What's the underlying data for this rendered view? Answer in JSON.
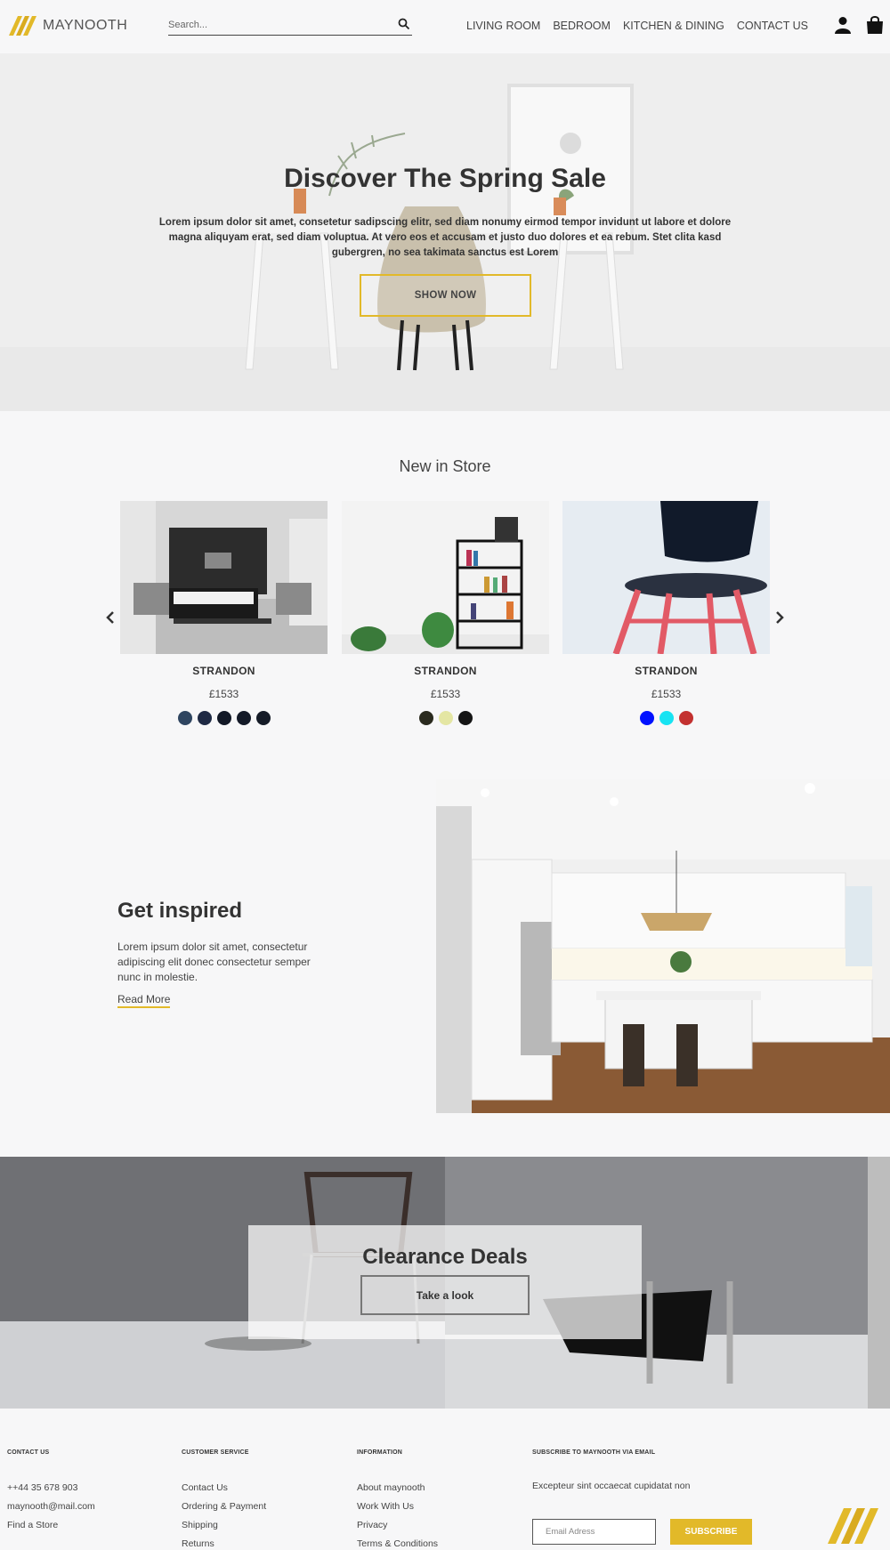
{
  "header": {
    "brand": "MAYNOOTH",
    "search_placeholder": "Search...",
    "nav": [
      "LIVING ROOM",
      "BEDROOM",
      "KITCHEN & DINING",
      "CONTACT US"
    ]
  },
  "hero": {
    "title": "Discover The Spring Sale",
    "text": "Lorem ipsum dolor sit amet, consetetur sadipscing elitr, sed diam nonumy eirmod tempor invidunt ut labore et dolore magna aliquyam erat, sed diam voluptua. At vero eos et accusam et justo duo dolores et ea rebum. Stet clita kasd gubergren, no sea takimata sanctus est Lorem",
    "button": "SHOW NOW"
  },
  "new_in_store": {
    "title": "New in Store",
    "products": [
      {
        "name": "STRANDON",
        "price": "£1533",
        "swatches": [
          "#2f4560",
          "#1f2a44",
          "#121826",
          "#141a28",
          "#151b27"
        ]
      },
      {
        "name": "STRANDON",
        "price": "£1533",
        "swatches": [
          "#2a2a1e",
          "#e4e6a3",
          "#151515"
        ]
      },
      {
        "name": "STRANDON",
        "price": "£1533",
        "swatches": [
          "#0011ff",
          "#17e3f2",
          "#c33130"
        ]
      }
    ]
  },
  "inspired": {
    "title": "Get inspired",
    "text": "Lorem ipsum dolor sit amet, consectetur adipiscing elit donec consectetur semper nunc in molestie.",
    "link": "Read More"
  },
  "clearance": {
    "title": "Clearance Deals",
    "button": "Take a look"
  },
  "footer": {
    "contact": {
      "heading": "CONTACT US",
      "items": [
        "++44 35 678 903",
        "maynooth@mail.com",
        "Find a Store"
      ]
    },
    "service": {
      "heading": "CUSTOMER SERVICE",
      "items": [
        "Contact Us",
        "Ordering & Payment",
        "Shipping",
        "Returns"
      ]
    },
    "information": {
      "heading": "INFORMATION",
      "items": [
        "About maynooth",
        "Work With Us",
        "Privacy",
        "Terms & Conditions"
      ]
    },
    "subscribe": {
      "heading": "SUBSCRIBE TO MAYNOOTH VIA EMAIL",
      "text": "Excepteur sint occaecat cupidatat non",
      "email_placeholder": "Email Adress",
      "button": "SUBSCRIBE"
    }
  },
  "colors": {
    "accent": "#e2b929",
    "background": "#f7f7f8"
  }
}
